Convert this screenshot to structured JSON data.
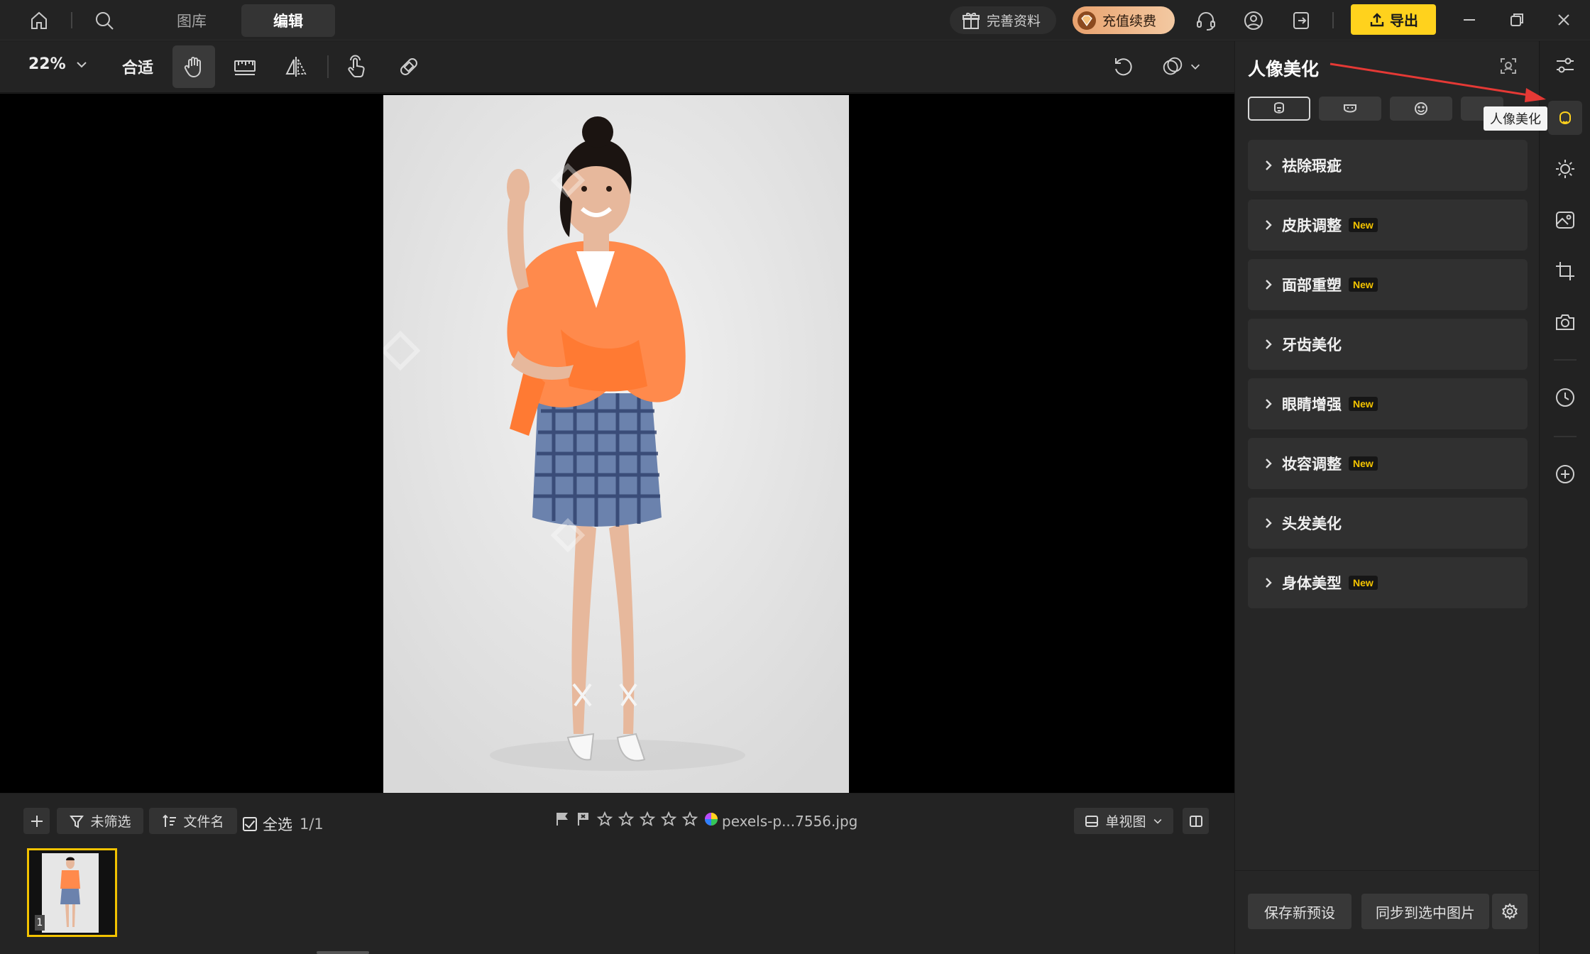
{
  "topbar": {
    "tabs": [
      {
        "label": "图库",
        "active": false
      },
      {
        "label": "编辑",
        "active": true
      }
    ],
    "profile_label": "完善资料",
    "renew_label": "充值续费",
    "export_label": "导出"
  },
  "toolbar": {
    "zoom": "22%",
    "fit_label": "合适"
  },
  "bottombar": {
    "filter_label": "未筛选",
    "sort_label": "文件名",
    "select_all_label": "全选",
    "select_count": "1/1",
    "filename": "pexels-p...7556.jpg",
    "view_label": "单视图"
  },
  "filmstrip": {
    "items": [
      {
        "index": "1"
      }
    ]
  },
  "panel": {
    "title": "人像美化",
    "sections": [
      {
        "label": "祛除瑕疵",
        "new": false
      },
      {
        "label": "皮肤调整",
        "new": true
      },
      {
        "label": "面部重塑",
        "new": true
      },
      {
        "label": "牙齿美化",
        "new": false
      },
      {
        "label": "眼睛增强",
        "new": true
      },
      {
        "label": "妆容调整",
        "new": true
      },
      {
        "label": "头发美化",
        "new": false
      },
      {
        "label": "身体美型",
        "new": true
      }
    ],
    "new_badge": "New",
    "save_preset_label": "保存新预设",
    "sync_label": "同步到选中图片"
  },
  "tooltip": "人像美化",
  "colors": {
    "accent": "#ffd21d",
    "new_badge": "#f5c400",
    "annotation": "#e53935"
  }
}
